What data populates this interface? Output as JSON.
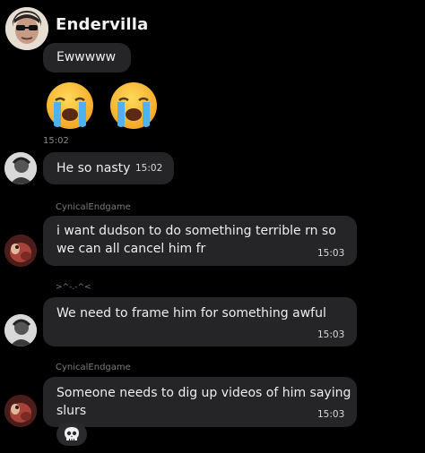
{
  "chat": {
    "header_sender": "Endervilla",
    "messages": [
      {
        "text": "Ewwwww"
      },
      {
        "text": "",
        "reactions": [
          "loudly-crying-face",
          "loudly-crying-face"
        ]
      },
      {
        "group_time": "15:02"
      },
      {
        "text": "He so nasty",
        "time": "15:02"
      },
      {
        "sender": "CynicalEndgame",
        "lines": [
          "i want dudson to do something terrible rn so",
          "we can all cancel him fr"
        ],
        "time": "15:03"
      },
      {
        "sender": ">^-.-^<",
        "text": "We need to frame him for something awful",
        "time": "15:03"
      },
      {
        "sender": "CynicalEndgame",
        "lines": [
          "Someone needs to dig up videos of him saying",
          "slurs"
        ],
        "time": "15:03",
        "reaction": "skull-icon"
      }
    ]
  },
  "colors": {
    "background": "#000000",
    "bubble": "#252527",
    "sender_label": "#7b7b7b"
  }
}
